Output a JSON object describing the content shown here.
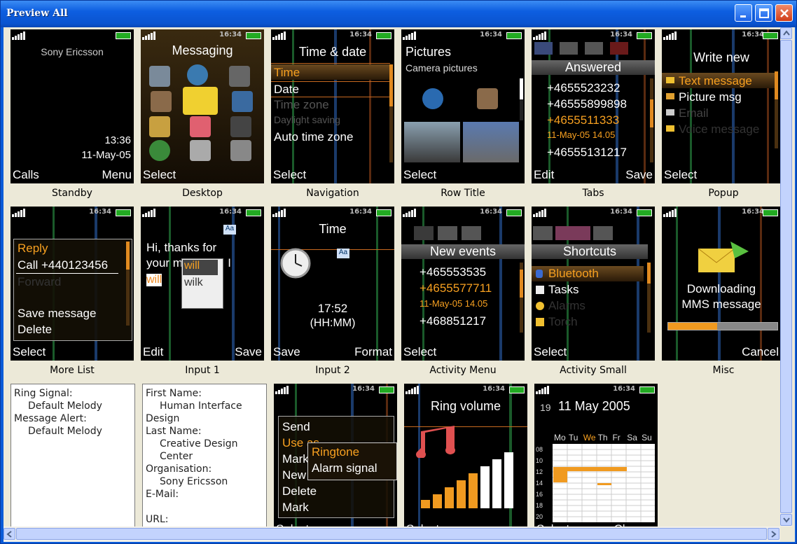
{
  "window": {
    "title": "Preview All"
  },
  "clock": "16:34",
  "previews": [
    {
      "caption": "Standby",
      "brand": "Sony Ericsson",
      "time": "13:36",
      "date": "11-May-05",
      "left": "Calls",
      "right": "Menu"
    },
    {
      "caption": "Desktop",
      "header": "Messaging",
      "left": "Select"
    },
    {
      "caption": "Navigation",
      "header": "Time & date",
      "items": [
        "Time",
        "Date",
        "Time zone",
        "Daylight saving",
        "Auto time zone"
      ],
      "left": "Select"
    },
    {
      "caption": "Row Title",
      "header": "Pictures",
      "sub": "Camera pictures",
      "left": "Select"
    },
    {
      "caption": "Tabs",
      "header": "Answered",
      "items": [
        "+4655523232",
        "+46555899898",
        "+4655511333",
        "+46555131217"
      ],
      "meta": "11-May-05     14.05",
      "left": "Edit",
      "right": "Save"
    },
    {
      "caption": "Popup",
      "header": "Write new",
      "items": [
        "Text message",
        "Picture msg",
        "Email",
        "Voice message"
      ],
      "left": "Select"
    },
    {
      "caption": "More List",
      "items": [
        "Reply",
        "Call +440123456",
        "Forward",
        "Save message",
        "Delete"
      ],
      "left": "Select"
    },
    {
      "caption": "Input 1",
      "text": "Hi, thanks for your message. I",
      "typed": "will",
      "suggestions": [
        "will",
        "wilk"
      ],
      "left": "Edit",
      "right": "Save"
    },
    {
      "caption": "Input 2",
      "header": "Time",
      "value": "17:52",
      "unit": "(HH:MM)",
      "left": "Save",
      "right": "Format"
    },
    {
      "caption": "Activity Menu",
      "header": "New events",
      "items": [
        "+465553535",
        "+4655577711",
        "+468851217"
      ],
      "meta": "11-May-05     14.05",
      "left": "Select"
    },
    {
      "caption": "Activity Small",
      "header": "Shortcuts",
      "items": [
        "Bluetooth",
        "Tasks",
        "Alarms",
        "Torch"
      ],
      "left": "Select"
    },
    {
      "caption": "Misc",
      "line1": "Downloading",
      "line2": "MMS message",
      "right": "Cancel",
      "progress": 0.45
    }
  ],
  "ring_panel": [
    "Ring Signal:",
    "Default Melody",
    "Message Alert:",
    "Default Melody"
  ],
  "contact_panel": [
    "First Name:",
    "Human Interface",
    "Design",
    "Last Name:",
    "Creative Design Center",
    "Organisation:",
    "Sony Ericsson",
    "E-Mail:",
    "",
    "URL:"
  ],
  "menu_preview": {
    "items": [
      "Send",
      "Use as",
      "Mark",
      "New",
      "Delete",
      "Mark"
    ],
    "submenu": [
      "Ringtone",
      "Alarm signal"
    ],
    "left": "Select"
  },
  "volume_preview": {
    "header": "Ring volume",
    "left": "Select"
  },
  "calendar_preview": {
    "week": "19",
    "date": "11 May 2005",
    "days": [
      "Mo",
      "Tu",
      "We",
      "Th",
      "Fr",
      "Sa",
      "Su"
    ],
    "hours": [
      "08",
      "10",
      "12",
      "14",
      "16",
      "18",
      "20"
    ],
    "left": "Select",
    "right": "Change"
  }
}
